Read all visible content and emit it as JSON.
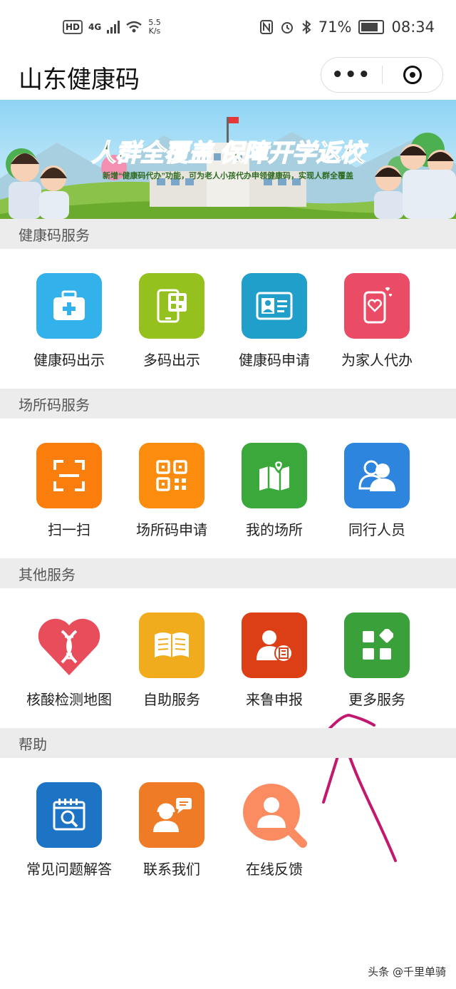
{
  "status_bar": {
    "hd": "HD",
    "signal": "4G",
    "speed_value": "5.5",
    "speed_unit": "K/s",
    "battery": "71%",
    "time": "08:34"
  },
  "title_bar": {
    "title": "山东健康码",
    "more_label": "•••"
  },
  "banner": {
    "headline": "人群全覆盖  保障开学返校",
    "subline": "新增“健康码代办”功能，可为老人小孩代办申领健康码，实现人群全覆盖"
  },
  "sections": [
    {
      "title": "健康码服务",
      "items": [
        {
          "label": "健康码出示",
          "icon": "medical-kit-icon",
          "color": "#33b1ea"
        },
        {
          "label": "多码出示",
          "icon": "phone-qr-icon",
          "color": "#95c11f"
        },
        {
          "label": "健康码申请",
          "icon": "id-card-icon",
          "color": "#1f9fc9"
        },
        {
          "label": "为家人代办",
          "icon": "phone-heart-icon",
          "color": "#ea4c66"
        }
      ]
    },
    {
      "title": "场所码服务",
      "items": [
        {
          "label": "扫一扫",
          "icon": "scan-icon",
          "color": "#fb7d0b"
        },
        {
          "label": "场所码申请",
          "icon": "qr-code-icon",
          "color": "#fb8c0e"
        },
        {
          "label": "我的场所",
          "icon": "map-pin-icon",
          "color": "#3aa83a"
        },
        {
          "label": "同行人员",
          "icon": "people-icon",
          "color": "#2d85dd"
        }
      ]
    },
    {
      "title": "其他服务",
      "items": [
        {
          "label": "核酸检测地图",
          "icon": "dna-heart-icon",
          "color": "#e84d5b"
        },
        {
          "label": "自助服务",
          "icon": "book-icon",
          "color": "#f0ac1d"
        },
        {
          "label": "来鲁申报",
          "icon": "person-form-icon",
          "color": "#dc3e16"
        },
        {
          "label": "更多服务",
          "icon": "apps-grid-icon",
          "color": "#3aa03a"
        }
      ]
    },
    {
      "title": "帮助",
      "items": [
        {
          "label": "常见问题解答",
          "icon": "calendar-search-icon",
          "color": "#1d73c4"
        },
        {
          "label": "联系我们",
          "icon": "support-agent-icon",
          "color": "#f07b26"
        },
        {
          "label": "在线反馈",
          "icon": "feedback-search-icon",
          "color": "#fb8c62"
        }
      ]
    }
  ],
  "watermark": "头条 @千里单骑"
}
